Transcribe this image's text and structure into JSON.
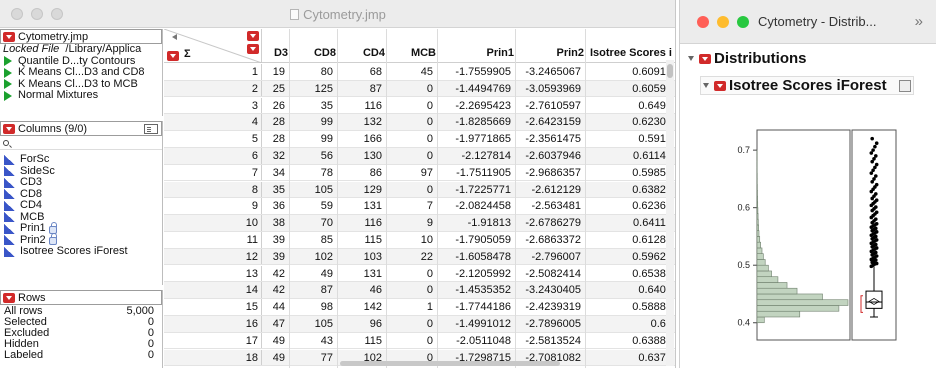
{
  "main_window": {
    "title": "Cytometry.jmp"
  },
  "table_panel": {
    "name": "Cytometry.jmp",
    "locked_label": "Locked File",
    "path": "/Library/Applica",
    "scripts": [
      "Quantile D...ty Contours",
      "K Means Cl...D3 and CD8",
      "K Means Cl...D3 to MCB",
      "Normal Mixtures"
    ]
  },
  "columns_panel": {
    "header": "Columns (9/0)",
    "search_placeholder": "",
    "items": [
      {
        "name": "ForSc",
        "locked": false
      },
      {
        "name": "SideSc",
        "locked": false
      },
      {
        "name": "CD3",
        "locked": false
      },
      {
        "name": "CD8",
        "locked": false
      },
      {
        "name": "CD4",
        "locked": false
      },
      {
        "name": "MCB",
        "locked": false
      },
      {
        "name": "Prin1",
        "locked": true
      },
      {
        "name": "Prin2",
        "locked": true
      },
      {
        "name": "Isotree Scores iForest",
        "locked": false
      }
    ]
  },
  "rows_panel": {
    "header": "Rows",
    "stats": [
      {
        "label": "All rows",
        "value": "5,000"
      },
      {
        "label": "Selected",
        "value": "0"
      },
      {
        "label": "Excluded",
        "value": "0"
      },
      {
        "label": "Hidden",
        "value": "0"
      },
      {
        "label": "Labeled",
        "value": "0"
      }
    ]
  },
  "grid": {
    "sigma_label": "Σ",
    "columns": [
      "D3",
      "CD8",
      "CD4",
      "MCB",
      "Prin1",
      "Prin2",
      "Isotree Scores i"
    ],
    "rows": [
      [
        "1",
        "19",
        "80",
        "68",
        "45",
        "-1.7559905",
        "-3.2465067",
        "0.60912"
      ],
      [
        "2",
        "25",
        "125",
        "87",
        "0",
        "-1.4494769",
        "-3.0593969",
        "0.60596"
      ],
      [
        "3",
        "26",
        "35",
        "116",
        "0",
        "-2.2695423",
        "-2.7610597",
        "0.6493"
      ],
      [
        "4",
        "28",
        "99",
        "132",
        "0",
        "-1.8285669",
        "-2.6423159",
        "0.62308"
      ],
      [
        "5",
        "28",
        "99",
        "166",
        "0",
        "-1.9771865",
        "-2.3561475",
        "0.5918"
      ],
      [
        "6",
        "32",
        "56",
        "130",
        "0",
        "-2.127814",
        "-2.6037946",
        "0.61143"
      ],
      [
        "7",
        "34",
        "78",
        "86",
        "97",
        "-1.7511905",
        "-2.9686357",
        "0.59855"
      ],
      [
        "8",
        "35",
        "105",
        "129",
        "0",
        "-1.7225771",
        "-2.612129",
        "0.63822"
      ],
      [
        "9",
        "36",
        "59",
        "131",
        "7",
        "-2.0824458",
        "-2.563481",
        "0.62365"
      ],
      [
        "10",
        "38",
        "70",
        "116",
        "9",
        "-1.91813",
        "-2.6786279",
        "0.64116"
      ],
      [
        "11",
        "39",
        "85",
        "115",
        "10",
        "-1.7905059",
        "-2.6863372",
        "0.61283"
      ],
      [
        "12",
        "39",
        "102",
        "103",
        "22",
        "-1.6058478",
        "-2.796007",
        "0.59623"
      ],
      [
        "13",
        "42",
        "49",
        "131",
        "0",
        "-2.1205992",
        "-2.5082414",
        "0.65385"
      ],
      [
        "14",
        "42",
        "87",
        "46",
        "0",
        "-1.4535352",
        "-3.2430405",
        "0.6400"
      ],
      [
        "15",
        "44",
        "98",
        "142",
        "1",
        "-1.7744186",
        "-2.4239319",
        "0.58884"
      ],
      [
        "16",
        "47",
        "105",
        "96",
        "0",
        "-1.4991012",
        "-2.7896005",
        "0.60"
      ],
      [
        "17",
        "49",
        "43",
        "115",
        "0",
        "-2.0511048",
        "-2.5813524",
        "0.63885"
      ],
      [
        "18",
        "49",
        "77",
        "102",
        "0",
        "-1.7298715",
        "-2.7081082",
        "0.6374"
      ]
    ]
  },
  "dist_window": {
    "title": "Cytometry - Distrib...",
    "overflow_glyph": "»",
    "distributions_label": "Distributions",
    "variable_label": "Isotree Scores iForest",
    "traffic_colors": [
      "#ff5f57",
      "#febc2e",
      "#28c840"
    ],
    "accent": "#d12a2a",
    "histogram_fill": "#c2d4c0"
  },
  "chart_data": {
    "type": "histogram",
    "title": "Isotree Scores iForest",
    "ylim": [
      0.37,
      0.735
    ],
    "yticks": [
      "0.4",
      "0.5",
      "0.6",
      "0.7"
    ],
    "bin_width": 0.01,
    "bins": [
      {
        "lo": 0.4,
        "count": 80
      },
      {
        "lo": 0.41,
        "count": 470
      },
      {
        "lo": 0.42,
        "count": 900
      },
      {
        "lo": 0.43,
        "count": 1000
      },
      {
        "lo": 0.44,
        "count": 720
      },
      {
        "lo": 0.45,
        "count": 440
      },
      {
        "lo": 0.46,
        "count": 330
      },
      {
        "lo": 0.47,
        "count": 230
      },
      {
        "lo": 0.48,
        "count": 160
      },
      {
        "lo": 0.49,
        "count": 125
      },
      {
        "lo": 0.5,
        "count": 90
      },
      {
        "lo": 0.51,
        "count": 70
      },
      {
        "lo": 0.52,
        "count": 55
      },
      {
        "lo": 0.53,
        "count": 40
      },
      {
        "lo": 0.54,
        "count": 30
      },
      {
        "lo": 0.55,
        "count": 22
      },
      {
        "lo": 0.56,
        "count": 18
      },
      {
        "lo": 0.57,
        "count": 14
      },
      {
        "lo": 0.58,
        "count": 12
      },
      {
        "lo": 0.59,
        "count": 10
      },
      {
        "lo": 0.6,
        "count": 8
      },
      {
        "lo": 0.61,
        "count": 6
      },
      {
        "lo": 0.62,
        "count": 5
      },
      {
        "lo": 0.63,
        "count": 4
      },
      {
        "lo": 0.64,
        "count": 3
      },
      {
        "lo": 0.65,
        "count": 3
      },
      {
        "lo": 0.66,
        "count": 2
      },
      {
        "lo": 0.67,
        "count": 2
      },
      {
        "lo": 0.68,
        "count": 1
      },
      {
        "lo": 0.69,
        "count": 1
      }
    ],
    "boxplot": {
      "whisker_low": 0.41,
      "q1": 0.425,
      "median": 0.436,
      "mean": 0.437,
      "q3": 0.455,
      "whisker_high": 0.497,
      "shortest_half": [
        0.418,
        0.447
      ]
    },
    "outliers": [
      0.498,
      0.5,
      0.502,
      0.503,
      0.505,
      0.507,
      0.509,
      0.51,
      0.512,
      0.514,
      0.516,
      0.518,
      0.52,
      0.522,
      0.524,
      0.526,
      0.528,
      0.53,
      0.532,
      0.534,
      0.536,
      0.538,
      0.54,
      0.542,
      0.544,
      0.546,
      0.548,
      0.55,
      0.552,
      0.554,
      0.556,
      0.558,
      0.56,
      0.562,
      0.564,
      0.566,
      0.568,
      0.57,
      0.572,
      0.574,
      0.577,
      0.58,
      0.583,
      0.586,
      0.589,
      0.592,
      0.595,
      0.598,
      0.601,
      0.604,
      0.607,
      0.61,
      0.613,
      0.616,
      0.62,
      0.624,
      0.628,
      0.632,
      0.636,
      0.64,
      0.645,
      0.65,
      0.655,
      0.66,
      0.665,
      0.67,
      0.675,
      0.68,
      0.685,
      0.69,
      0.695,
      0.7,
      0.706,
      0.712,
      0.72
    ]
  }
}
